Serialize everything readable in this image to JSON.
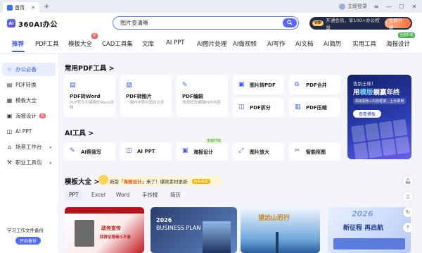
{
  "window": {
    "tab_label": "首页",
    "new_tab": "+",
    "login": "立即登录",
    "minimize": "—",
    "maximize": "☐",
    "close": "✕",
    "menu": "≡"
  },
  "header": {
    "logo_text": "360AI办公",
    "logo_mark": "AI",
    "search_value": "图片变清晰",
    "vip_badge": "VIP",
    "vip_text": "开通会员，享100+办公权益",
    "vip_button": "立即开通"
  },
  "nav": {
    "items": [
      "推荐",
      "PDF工具",
      "模板大全",
      "CAD工具集",
      "文库",
      "AI PPT",
      "AI图片处理",
      "AI做视频",
      "AI写作",
      "AI文档",
      "AI简历",
      "实用工具",
      "海报设计"
    ],
    "badge_new": "新",
    "badge_free": "全面升级"
  },
  "sidebar": {
    "items": [
      {
        "label": "办公必备",
        "icon": "star-icon"
      },
      {
        "label": "PDF转换",
        "icon": "pdf-icon"
      },
      {
        "label": "模板大全",
        "icon": "template-icon"
      },
      {
        "label": "海报设计",
        "icon": "poster-icon",
        "hot": "热"
      },
      {
        "label": "AI PPT",
        "icon": "ppt-icon"
      },
      {
        "label": "场景工作台",
        "icon": "workspace-icon",
        "arrow": "▸"
      },
      {
        "label": "职业工具包",
        "icon": "toolkit-icon",
        "arrow": "▸"
      }
    ],
    "promo_text": "学习工作文件备份",
    "promo_button": "开启备份"
  },
  "pdf_section": {
    "title": "常用PDF工具",
    "arrow": ">",
    "big_cards": [
      {
        "title": "PDF转Word",
        "desc": "PDF转为可编辑的Word文档"
      },
      {
        "title": "PDF转图片",
        "desc": "一键PDF转为图片文件"
      },
      {
        "title": "PDF编辑",
        "desc": "快速修改编辑PDF内容"
      }
    ],
    "small_cards": [
      "图片转PDF",
      "PDF合并",
      "PDF拆分",
      "PDF压缩"
    ]
  },
  "banner": {
    "line1": "告别土味！",
    "line2_a": "用",
    "line2_hl": "模版",
    "line2_b": "躺赢年终",
    "line3": "高级配色+内容框架，上手即用",
    "button": "查看模板"
  },
  "ai_section": {
    "title": "AI工具",
    "arrow": ">",
    "tools": [
      "AI帮我写",
      "AI PPT",
      "海报设计",
      "图片放大",
      "智能抠图"
    ],
    "upgrade_tag": "全面升级"
  },
  "template_section": {
    "title": "模板大全",
    "arrow": ">",
    "badge_prefix": "新版「",
    "badge_hl": "海报设计",
    "badge_suffix": "」来了！爆款素材更新",
    "badge_new": "抢先体验",
    "tabs": [
      "PPT",
      "Excel",
      "Word",
      "手抄报",
      "简历"
    ],
    "thumbs": [
      {
        "text": "政务宣传",
        "sub": "回首征程奋斗不息"
      },
      {
        "text": "2026",
        "sub": "BUSINESS PLAN"
      },
      {
        "text": "望远山而行",
        "sub": ""
      },
      {
        "text": "2026",
        "sub": "新征程 再启航"
      }
    ]
  },
  "right_rail": [
    "bell-icon",
    "mobile-icon",
    "refresh-icon",
    "top-icon"
  ],
  "colors": {
    "accent": "#3859ff",
    "vip_bg": "#1f2a4d",
    "hot": "#ff5a5a"
  }
}
